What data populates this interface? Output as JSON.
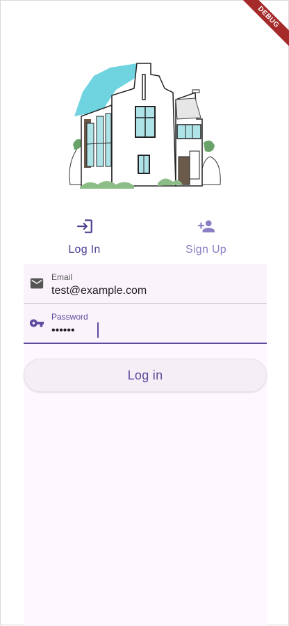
{
  "debug_banner": "DEBUG",
  "tabs": [
    {
      "label": "Log In",
      "icon": "login-icon",
      "active": true
    },
    {
      "label": "Sign Up",
      "icon": "person-add-icon",
      "active": false
    }
  ],
  "form": {
    "email": {
      "label": "Email",
      "value": "test@example.com",
      "icon": "email-icon"
    },
    "password": {
      "label": "Password",
      "value": "••••••",
      "icon": "key-icon"
    },
    "submit_label": "Log in"
  },
  "colors": {
    "accent": "#5b4a9e",
    "tab_inactive": "#8a7fc2",
    "panel_bg": "#fdf7fe",
    "debug_ribbon": "#a52a2a"
  }
}
